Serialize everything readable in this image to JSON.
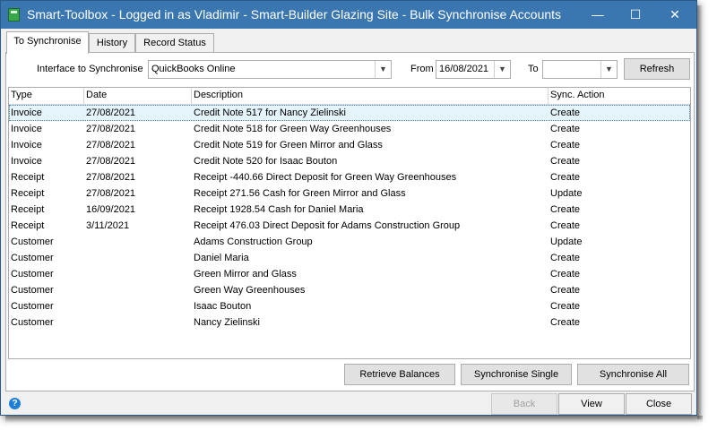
{
  "window": {
    "title": "Smart-Toolbox - Logged in as Vladimir - Smart-Builder Glazing Site - Bulk Synchronise Accounts",
    "min_glyph": "—",
    "max_glyph": "☐",
    "close_glyph": "✕",
    "app_icon": "toolbox-icon",
    "title_bar_color": "#3a76b0"
  },
  "tabs": [
    {
      "label": "To Synchronise",
      "active": true
    },
    {
      "label": "History",
      "active": false
    },
    {
      "label": "Record Status",
      "active": false
    }
  ],
  "filters": {
    "interface_label": "Interface to Synchronise",
    "interface_value": "QuickBooks Online",
    "from_label": "From",
    "from_value": "16/08/2021",
    "to_label": "To",
    "to_value": "",
    "refresh_label": "Refresh"
  },
  "grid": {
    "columns": [
      "Type",
      "Date",
      "Description",
      "Sync. Action"
    ],
    "rows": [
      {
        "type": "Invoice",
        "date": "27/08/2021",
        "description": "Credit Note 517 for Nancy Zielinski",
        "action": "Create"
      },
      {
        "type": "Invoice",
        "date": "27/08/2021",
        "description": "Credit Note 518 for Green Way Greenhouses",
        "action": "Create"
      },
      {
        "type": "Invoice",
        "date": "27/08/2021",
        "description": "Credit Note 519 for Green Mirror and Glass",
        "action": "Create"
      },
      {
        "type": "Invoice",
        "date": "27/08/2021",
        "description": "Credit Note 520 for Isaac Bouton",
        "action": "Create"
      },
      {
        "type": "Receipt",
        "date": "27/08/2021",
        "description": "Receipt -440.66 Direct Deposit for Green Way Greenhouses",
        "action": "Create"
      },
      {
        "type": "Receipt",
        "date": "27/08/2021",
        "description": "Receipt 271.56 Cash for Green Mirror and Glass",
        "action": "Update"
      },
      {
        "type": "Receipt",
        "date": "16/09/2021",
        "description": "Receipt 1928.54 Cash for Daniel  Maria",
        "action": "Create"
      },
      {
        "type": "Receipt",
        "date": "3/11/2021",
        "description": "Receipt 476.03 Direct Deposit for Adams Construction Group",
        "action": "Create"
      },
      {
        "type": "Customer",
        "date": "",
        "description": "Adams Construction Group",
        "action": "Update"
      },
      {
        "type": "Customer",
        "date": "",
        "description": "Daniel  Maria",
        "action": "Create"
      },
      {
        "type": "Customer",
        "date": "",
        "description": "Green Mirror and Glass",
        "action": "Create"
      },
      {
        "type": "Customer",
        "date": "",
        "description": "Green Way Greenhouses",
        "action": "Create"
      },
      {
        "type": "Customer",
        "date": "",
        "description": "Isaac Bouton",
        "action": "Create"
      },
      {
        "type": "Customer",
        "date": "",
        "description": "Nancy Zielinski",
        "action": "Create"
      }
    ]
  },
  "actions": {
    "retrieve_balances": "Retrieve Balances",
    "synchronise_single": "Synchronise Single",
    "synchronise_all": "Synchronise All"
  },
  "footer": {
    "help_glyph": "?",
    "back_label": "Back",
    "view_label": "View",
    "close_label": "Close"
  }
}
